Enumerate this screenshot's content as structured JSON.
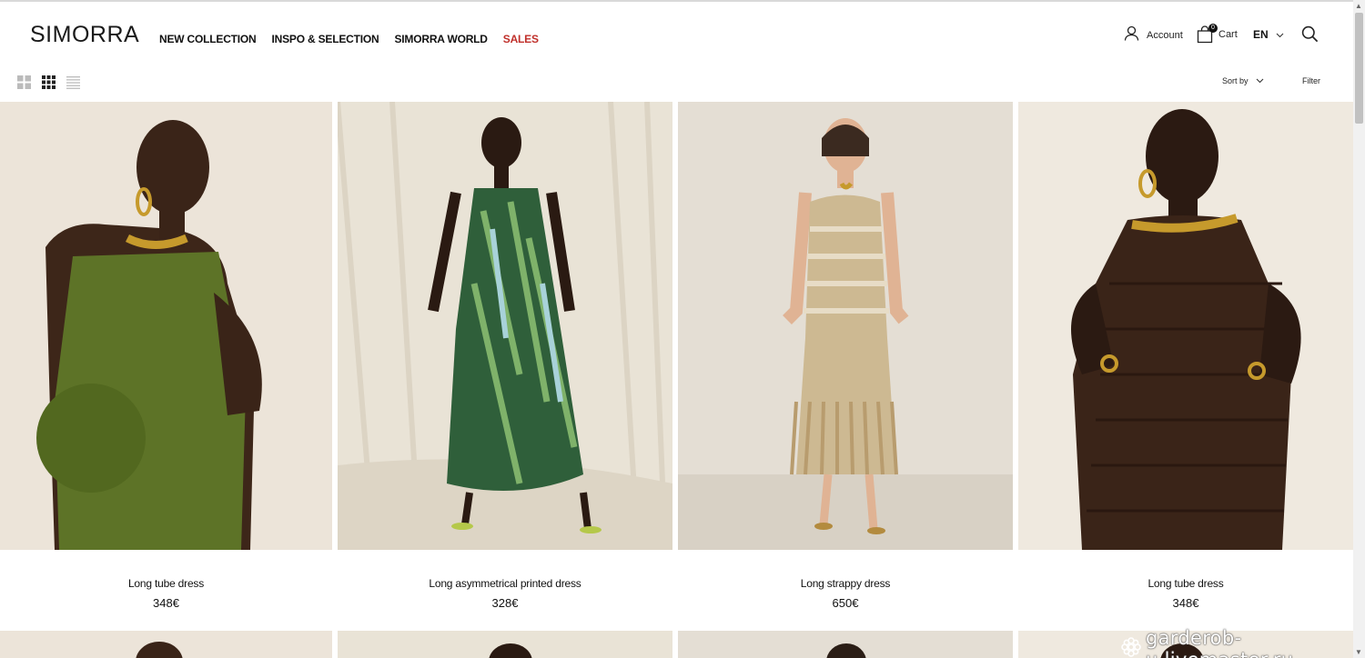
{
  "brand": {
    "logo": "SIMORRA"
  },
  "nav": {
    "items": [
      {
        "label": "NEW COLLECTION"
      },
      {
        "label": "INSPO & SELECTION"
      },
      {
        "label": "SIMORRA WORLD"
      },
      {
        "label": "SALES",
        "color": "#c0302b"
      }
    ]
  },
  "header": {
    "account_label": "Account",
    "cart_label": "Cart",
    "cart_count": "0",
    "language": "EN",
    "icons": [
      "user-icon",
      "bag-icon",
      "chevron-down-icon",
      "search-icon"
    ]
  },
  "toolbar": {
    "views": [
      "grid-2-icon",
      "grid-3-icon",
      "list-view-icon"
    ],
    "active_view": "grid-3-icon",
    "sort_label": "Sort by",
    "filter_label": "Filter"
  },
  "products": [
    {
      "name": "Long tube dress",
      "price": "348€",
      "color": "#5d7327"
    },
    {
      "name": "Long asymmetrical printed dress",
      "price": "328€",
      "color": "#2f5f3a"
    },
    {
      "name": "Long strappy dress",
      "price": "650€",
      "color": "#cdb992"
    },
    {
      "name": "Long tube dress",
      "price": "348€",
      "color": "#3a2418"
    }
  ],
  "watermark": "garderob-u.livemaster.ru"
}
